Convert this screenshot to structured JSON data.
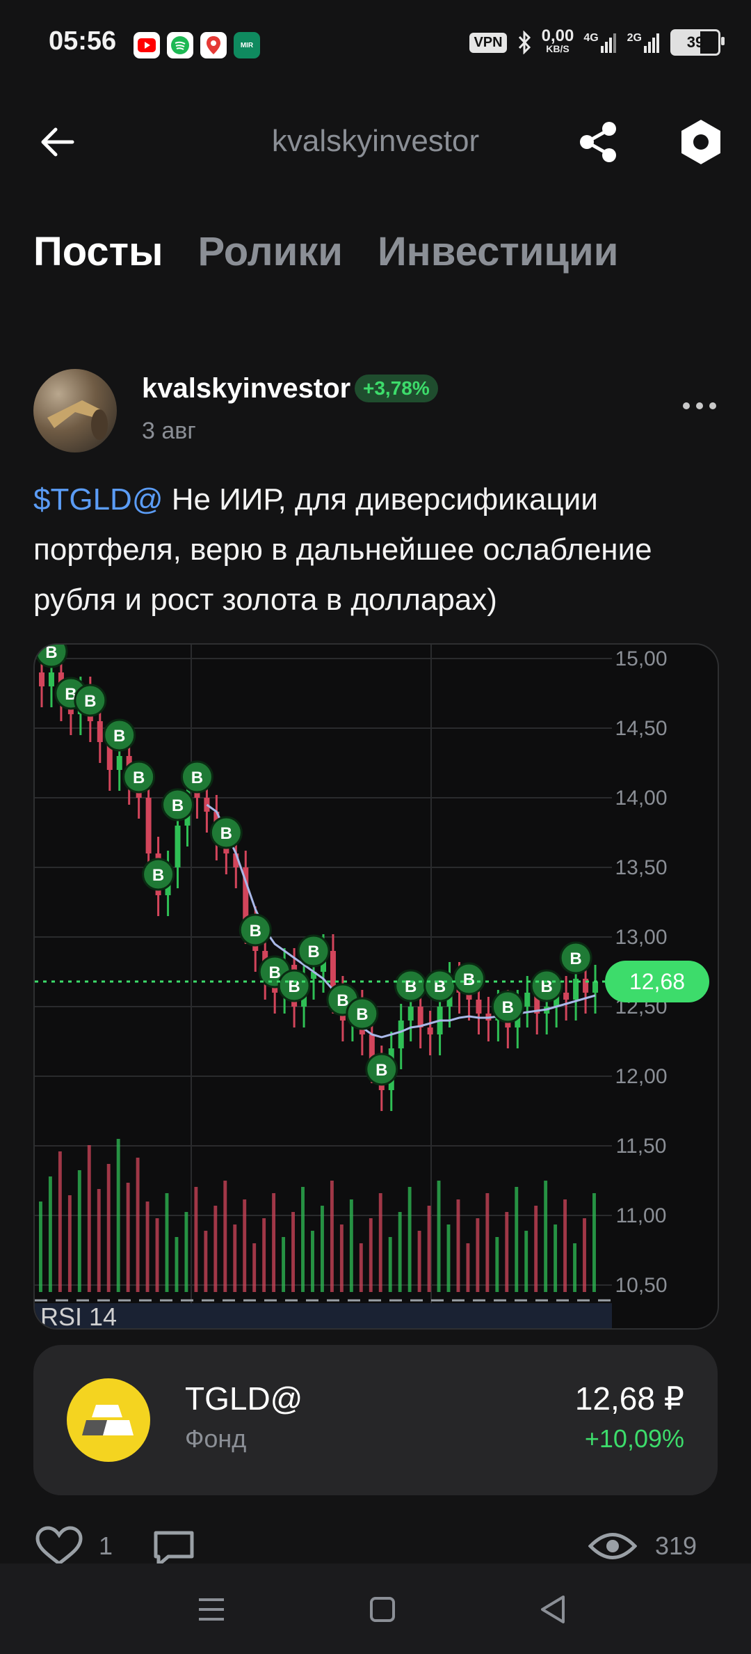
{
  "status_bar": {
    "time": "05:56",
    "vpn": "VPN",
    "net_speed": "0,00",
    "net_unit": "KB/S",
    "sig1": "4G",
    "sig2": "2G",
    "battery": "39"
  },
  "header": {
    "title": "kvalskyinvestor"
  },
  "tabs": [
    {
      "label": "Посты",
      "active": true
    },
    {
      "label": "Ролики",
      "active": false
    },
    {
      "label": "Инвестиции",
      "active": false
    }
  ],
  "post": {
    "author": "kvalskyinvestor",
    "author_change": "+3,78%",
    "date": "3 авг",
    "ticker_mention": "$TGLD@",
    "text": " Не ИИР, для диверсификации портфеля, верю в дальнейшее ослабление рубля и рост золота в долларах)"
  },
  "chart_data": {
    "type": "candlestick",
    "price_ticks": [
      "15,00",
      "14,50",
      "14,00",
      "13,50",
      "13,00",
      "12,50",
      "12,00",
      "11,50",
      "11,00",
      "10,50"
    ],
    "tick_values": [
      15.0,
      14.5,
      14.0,
      13.5,
      13.0,
      12.5,
      12.0,
      11.5,
      11.0,
      10.5
    ],
    "ylim": [
      10.4,
      15.1
    ],
    "current_price_label": "12,68",
    "current_price": 12.68,
    "indicator_label": "RSI 14",
    "buy_marker": "B",
    "close_values": [
      14.8,
      14.9,
      14.7,
      14.6,
      14.75,
      14.55,
      14.4,
      14.2,
      14.3,
      14.1,
      14.0,
      13.6,
      13.3,
      13.5,
      13.8,
      14.05,
      14.0,
      13.9,
      13.7,
      13.6,
      13.5,
      13.1,
      12.9,
      12.7,
      12.6,
      12.8,
      12.5,
      12.7,
      12.75,
      12.9,
      12.6,
      12.4,
      12.5,
      12.3,
      12.1,
      11.9,
      12.2,
      12.4,
      12.5,
      12.35,
      12.3,
      12.5,
      12.7,
      12.6,
      12.55,
      12.45,
      12.4,
      12.5,
      12.35,
      12.5,
      12.6,
      12.45,
      12.5,
      12.6,
      12.55,
      12.7,
      12.6,
      12.68
    ],
    "ma_values": [
      null,
      null,
      null,
      null,
      null,
      null,
      null,
      null,
      null,
      null,
      null,
      null,
      null,
      null,
      null,
      null,
      null,
      13.95,
      13.9,
      13.75,
      13.6,
      13.4,
      13.2,
      13.05,
      12.95,
      12.9,
      12.85,
      12.8,
      12.75,
      12.7,
      12.62,
      12.55,
      12.45,
      12.35,
      12.3,
      12.28,
      12.3,
      12.32,
      12.35,
      12.36,
      12.38,
      12.4,
      12.4,
      12.42,
      12.43,
      12.42,
      12.42,
      12.43,
      12.44,
      12.45,
      12.46,
      12.47,
      12.48,
      12.5,
      12.52,
      12.54,
      12.56,
      12.58
    ]
  },
  "instrument": {
    "ticker": "TGLD@",
    "type": "Фонд",
    "price": "12,68 ₽",
    "change": "+10,09%"
  },
  "actions": {
    "likes": "1",
    "views": "319"
  },
  "colors": {
    "accent_green": "#3ddc6b",
    "link_blue": "#5b9cf5",
    "candle_up": "#2fbf55",
    "candle_down": "#d2455b"
  }
}
